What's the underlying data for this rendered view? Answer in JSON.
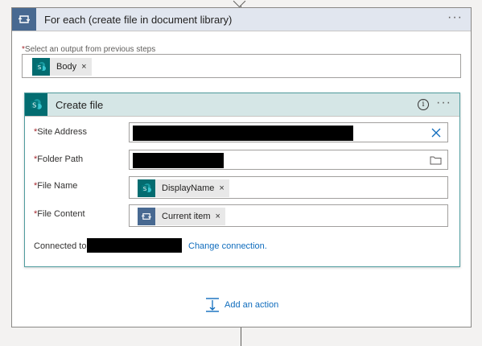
{
  "foreach": {
    "title": "For each (create file in document library)",
    "select_label": "Select an output from previous steps",
    "body_token": "Body"
  },
  "create_file": {
    "title": "Create file",
    "fields": [
      {
        "label": "Site Address"
      },
      {
        "label": "Folder Path"
      },
      {
        "label": "File Name",
        "token": "DisplayName"
      },
      {
        "label": "File Content",
        "token": "Current item"
      }
    ],
    "connected_label": "Connected to",
    "change_connection": "Change connection."
  },
  "add_action": "Add an action",
  "remove_glyph": "×",
  "required_marker": "*",
  "more_glyph": "···",
  "icons": [
    "loop-icon",
    "sharepoint-icon",
    "info-icon",
    "close-icon",
    "folder-icon",
    "add-action-icon"
  ],
  "colors": {
    "accent": "#0f6cbd",
    "foreach_header": "#e1e6ef",
    "sharepoint": "#036c70",
    "card_header": "#d5e6e6"
  }
}
